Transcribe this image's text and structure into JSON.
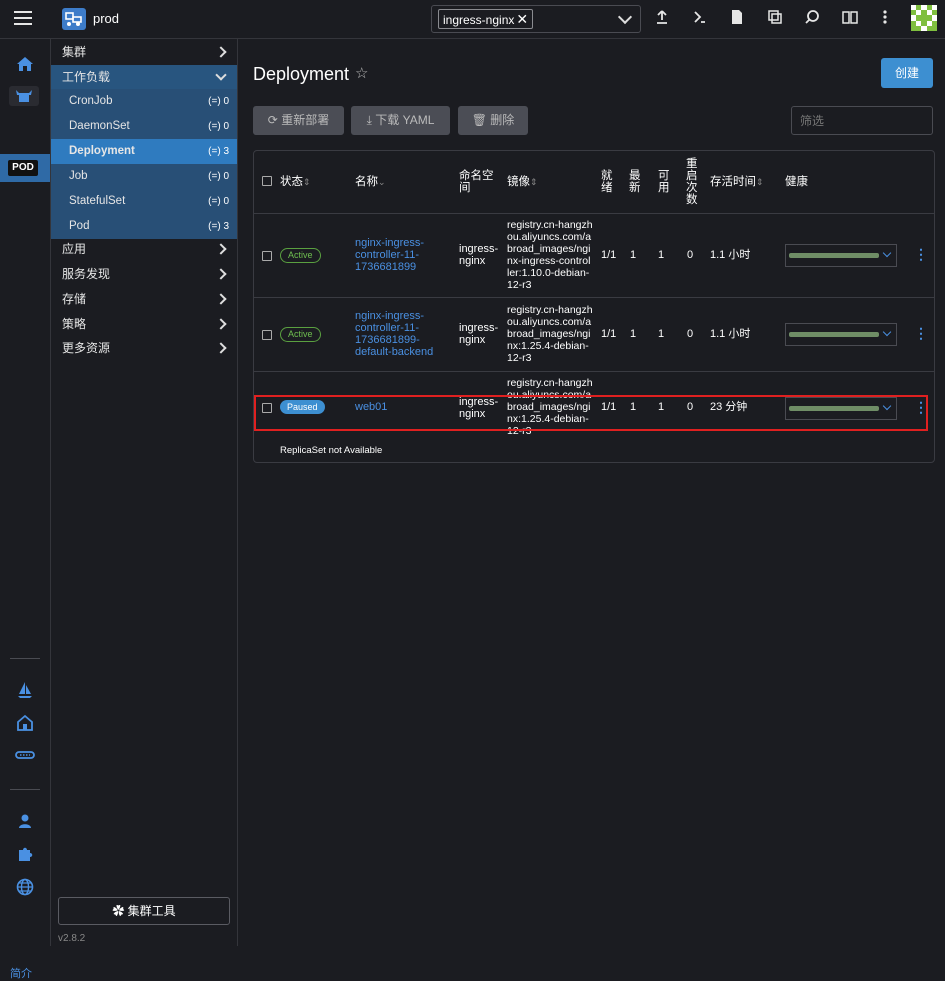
{
  "topbar": {
    "cluster_name": "prod",
    "namespace_chip": "ingress-nginx",
    "namespace_chip_close": "✕"
  },
  "rail": {
    "pod_badge": "POD",
    "about_label": "简介"
  },
  "sidebar": {
    "items": [
      {
        "label": "集群"
      },
      {
        "label": "工作负载"
      },
      {
        "label": "应用"
      },
      {
        "label": "服务发现"
      },
      {
        "label": "存储"
      },
      {
        "label": "策略"
      },
      {
        "label": "更多资源"
      }
    ],
    "workloads": [
      {
        "label": "CronJob",
        "count": "0"
      },
      {
        "label": "DaemonSet",
        "count": "0"
      },
      {
        "label": "Deployment",
        "count": "3"
      },
      {
        "label": "Job",
        "count": "0"
      },
      {
        "label": "StatefulSet",
        "count": "0"
      },
      {
        "label": "Pod",
        "count": "3"
      }
    ],
    "count_icon": "(=)",
    "cluster_tools_label": "✿ 集群工具",
    "version": "v2.8.2"
  },
  "main": {
    "title": "Deployment",
    "create_label": "创建",
    "redeploy_label": "重新部署",
    "download_label": "下载 YAML",
    "delete_label": "删除",
    "filter_placeholder": "筛选",
    "replicaset_message": "ReplicaSet not Available"
  },
  "table": {
    "headers": {
      "state": "状态",
      "name": "名称",
      "namespace_l1": "命名空",
      "namespace_l2": "间",
      "image": "镜像",
      "ready_l1": "就",
      "ready_l2": "绪",
      "uptodate_l1": "最",
      "uptodate_l2": "新",
      "available_l1": "可",
      "available_l2": "用",
      "restarts_l1": "重",
      "restarts_l2": "启",
      "restarts_l3": "次",
      "restarts_l4": "数",
      "age": "存活时间",
      "health": "健康"
    },
    "rows": [
      {
        "state": "Active",
        "name_lines": [
          "nginx-ingress-",
          "controller-11-",
          "1736681899"
        ],
        "namespace_lines": [
          "ingress-",
          "nginx"
        ],
        "image_lines": [
          "registry.cn-hangzh",
          "ou.aliyuncs.com/a",
          "broad_images/ngi",
          "nx-ingress-control",
          "ler:1.10.0-debian-",
          "12-r3"
        ],
        "ready": "1/1",
        "uptodate": "1",
        "available": "1",
        "restarts": "0",
        "age": "1.1 小时"
      },
      {
        "state": "Active",
        "name_lines": [
          "nginx-ingress-",
          "controller-11-",
          "1736681899-",
          "default-backend"
        ],
        "namespace_lines": [
          "ingress-",
          "nginx"
        ],
        "image_lines": [
          "registry.cn-hangzh",
          "ou.aliyuncs.com/a",
          "broad_images/ngi",
          "nx:1.25.4-debian-",
          "12-r3"
        ],
        "ready": "1/1",
        "uptodate": "1",
        "available": "1",
        "restarts": "0",
        "age": "1.1 小时"
      },
      {
        "state": "Paused",
        "name_lines": [
          "web01"
        ],
        "namespace_lines": [
          "ingress-",
          "nginx"
        ],
        "image_lines": [
          "registry.cn-hangzh",
          "ou.aliyuncs.com/a",
          "broad_images/ngi",
          "nx:1.25.4-debian-",
          "12-r3"
        ],
        "ready": "1/1",
        "uptodate": "1",
        "available": "1",
        "restarts": "0",
        "age": "23 分钟"
      }
    ]
  },
  "icons": {
    "menu": "hamburger-icon",
    "cluster": "cluster-icon",
    "upload": "upload-icon",
    "terminal": "terminal-icon",
    "file": "file-icon",
    "copy": "copy-icon",
    "search": "search-icon",
    "book": "book-icon",
    "more": "more-vertical-icon",
    "home": "home-icon",
    "sail": "sail-icon",
    "castle": "castle-icon",
    "link": "link-icon",
    "user": "user-icon",
    "puzzle": "puzzle-icon",
    "globe": "globe-icon"
  }
}
